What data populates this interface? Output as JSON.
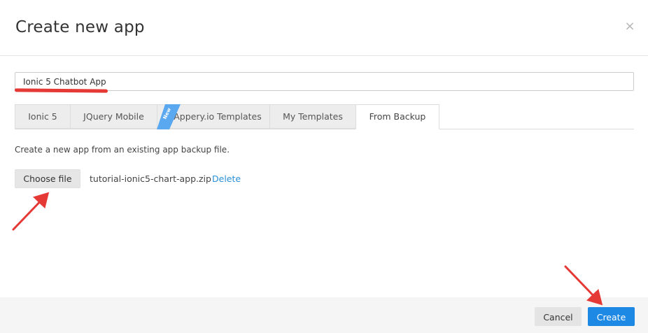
{
  "dialog": {
    "title": "Create new app",
    "close_glyph": "×"
  },
  "app_name": {
    "value": "Ionic 5 Chatbot App"
  },
  "tabs": [
    {
      "label": "Ionic 5",
      "active": false
    },
    {
      "label": "JQuery Mobile",
      "active": false
    },
    {
      "label": "Appery.io Templates",
      "active": false,
      "badge": "New"
    },
    {
      "label": "My Templates",
      "active": false
    },
    {
      "label": "From Backup",
      "active": true
    }
  ],
  "backup": {
    "description": "Create a new app from an existing app backup file.",
    "choose_label": "Choose file",
    "file_name": "tutorial-ionic5-chart-app.zip",
    "delete_label": "Delete"
  },
  "footer": {
    "cancel_label": "Cancel",
    "create_label": "Create"
  },
  "colors": {
    "accent": "#1e88e5",
    "link": "#2a8fd6",
    "annotation": "#e53935"
  },
  "icons": {
    "close": "close-icon"
  }
}
